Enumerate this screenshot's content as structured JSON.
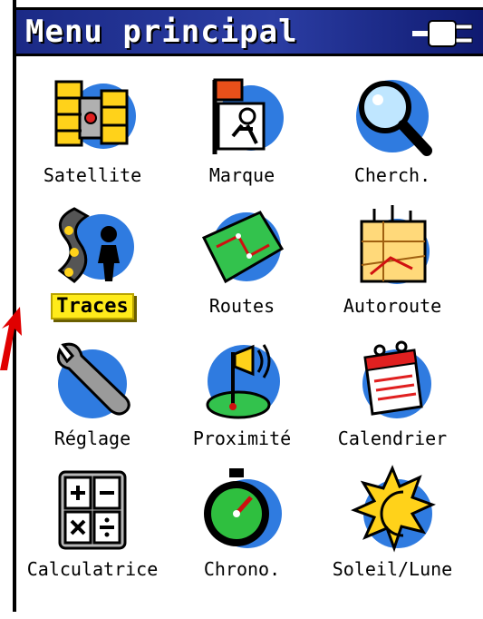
{
  "window": {
    "title": "Menu principal"
  },
  "colors": {
    "title_bg": "#1b2a86",
    "selection": "#ffeb1a",
    "accent_blue": "#2f7be0",
    "pointer_arrow": "#e00000"
  },
  "menu": {
    "selected": "Traces",
    "items": [
      {
        "label": "Satellite",
        "icon": "satellite-icon"
      },
      {
        "label": "Marque",
        "icon": "waypoint-mark-icon"
      },
      {
        "label": "Cherch.",
        "icon": "magnifier-icon"
      },
      {
        "label": "Traces",
        "icon": "tracks-icon"
      },
      {
        "label": "Routes",
        "icon": "routes-map-icon"
      },
      {
        "label": "Autoroute",
        "icon": "highway-map-icon"
      },
      {
        "label": "Réglage",
        "icon": "wrench-icon"
      },
      {
        "label": "Proximité",
        "icon": "proximity-alarm-icon"
      },
      {
        "label": "Calendrier",
        "icon": "calendar-icon"
      },
      {
        "label": "Calculatrice",
        "icon": "calculator-icon"
      },
      {
        "label": "Chrono.",
        "icon": "stopwatch-icon"
      },
      {
        "label": "Soleil/Lune",
        "icon": "sun-moon-icon"
      }
    ]
  }
}
